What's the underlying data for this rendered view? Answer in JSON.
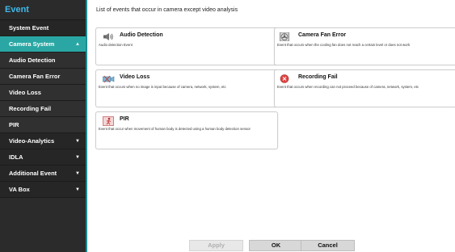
{
  "sidebar": {
    "title": "Event",
    "items": [
      {
        "label": "System Event",
        "kind": "group",
        "caret": ""
      },
      {
        "label": "Camera System",
        "kind": "active",
        "caret": "▲"
      },
      {
        "label": "Audio Detection",
        "kind": "sub",
        "caret": ""
      },
      {
        "label": "Camera Fan Error",
        "kind": "sub",
        "caret": ""
      },
      {
        "label": "Video Loss",
        "kind": "sub",
        "caret": ""
      },
      {
        "label": "Recording Fail",
        "kind": "sub",
        "caret": ""
      },
      {
        "label": "PIR",
        "kind": "sub",
        "caret": ""
      },
      {
        "label": "Video-Analytics",
        "kind": "group",
        "caret": "▼"
      },
      {
        "label": "IDLA",
        "kind": "group",
        "caret": "▼"
      },
      {
        "label": "Additional Event",
        "kind": "group",
        "caret": "▼"
      },
      {
        "label": "VA Box",
        "kind": "group",
        "caret": "▼"
      }
    ]
  },
  "main": {
    "header": "List of events that occur in camera except video analysis",
    "cards": [
      {
        "title": "Audio Detection",
        "desc": "Audio detection Event",
        "icon": "speaker-icon"
      },
      {
        "title": "Camera Fan Error",
        "desc": "Event that occurs when the cooling fan does not reach a certain level or does not work",
        "icon": "fan-icon"
      },
      {
        "title": "Video Loss",
        "desc": "Event that occurs when no image is input because of camera, network, system, etc",
        "icon": "video-loss-icon"
      },
      {
        "title": "Recording Fail",
        "desc": "Event that occurs when recording can not proceed because of camera, network, system, etc",
        "icon": "record-fail-icon"
      },
      {
        "title": "PIR",
        "desc": "Event that occur when movement of human body is detected using a human body detection sensor",
        "icon": "pir-icon"
      }
    ]
  },
  "buttons": {
    "apply": "Apply",
    "ok": "OK",
    "cancel": "Cancel"
  },
  "colors": {
    "accent": "#3fb8e8",
    "active_item": "#2aa7a4",
    "sidebar_bg": "#2b2b2b"
  }
}
